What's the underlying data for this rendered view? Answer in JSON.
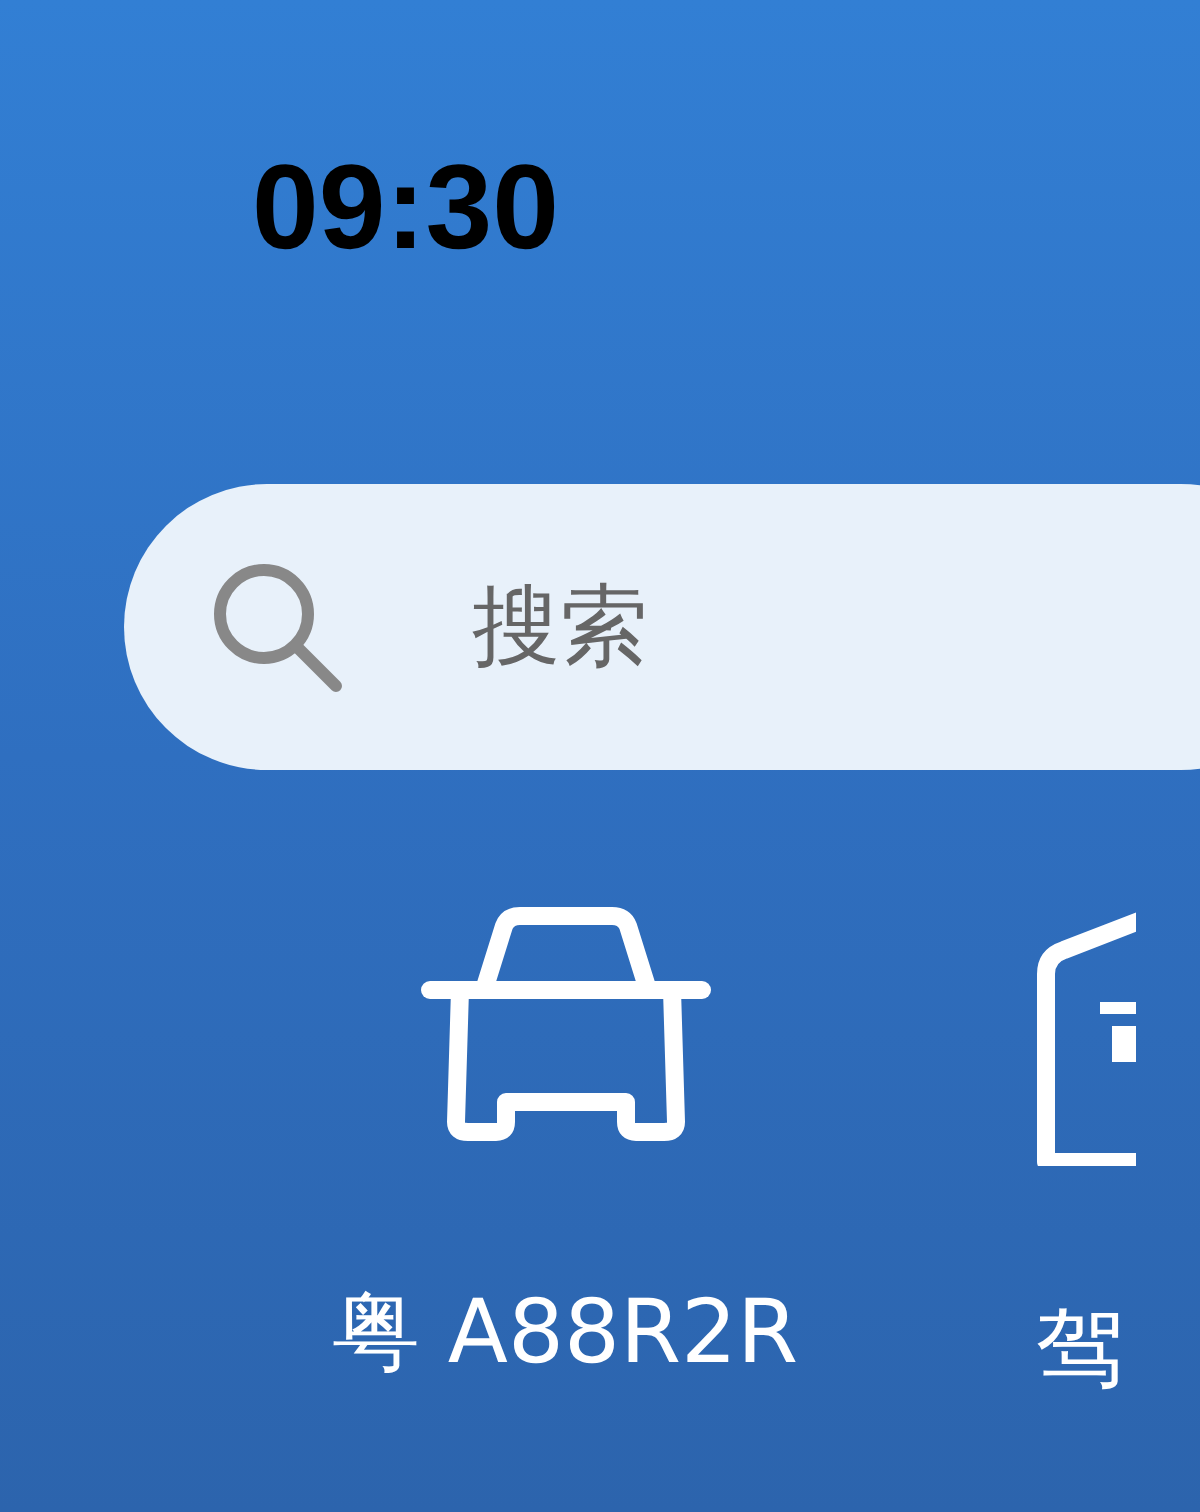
{
  "status_bar": {
    "time": "09:30"
  },
  "search": {
    "placeholder": "搜索"
  },
  "shortcuts": [
    {
      "kind": "car",
      "label": "粤 A88R2R"
    },
    {
      "kind": "license",
      "label": "驾"
    }
  ]
}
